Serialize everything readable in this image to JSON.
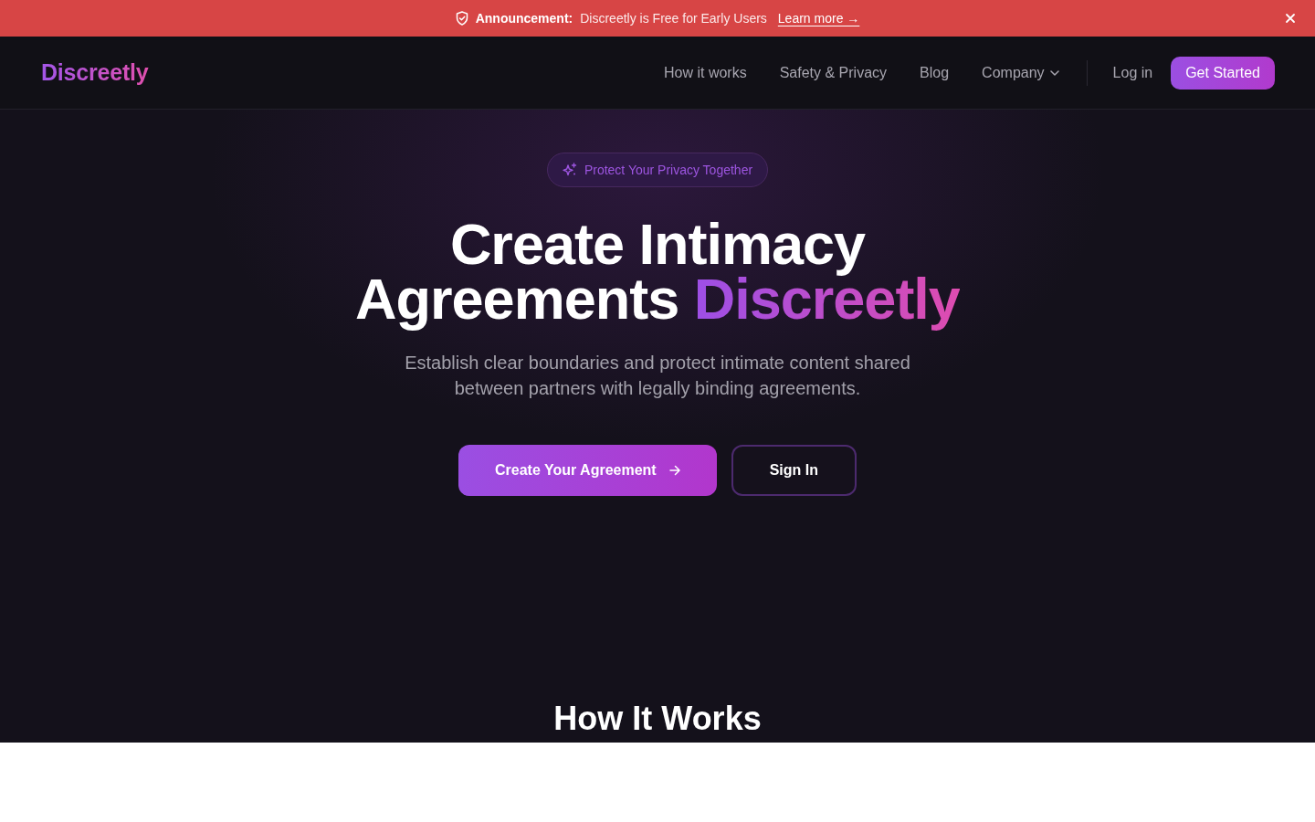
{
  "announcement": {
    "label": "Announcement:",
    "message": "Discreetly is Free for Early Users",
    "link": "Learn more →"
  },
  "navbar": {
    "brand": "Discreetly",
    "links": [
      {
        "label": "How it works",
        "kind": "link"
      },
      {
        "label": "Safety & Privacy",
        "kind": "link"
      },
      {
        "label": "Blog",
        "kind": "link"
      },
      {
        "label": "Company",
        "kind": "dropdown"
      }
    ],
    "login": "Log in",
    "cta": "Get Started"
  },
  "hero": {
    "badge": "Protect Your Privacy Together",
    "headline": {
      "lines": [
        "Create Intimacy",
        "Agreements"
      ],
      "highlight": "Discreetly"
    },
    "subtitle": "Establish clear boundaries and protect intimate content shared between partners with legally binding agreements.",
    "buttons": [
      {
        "label": "Create Your Agreement",
        "kind": "primary"
      },
      {
        "label": "Sign In",
        "kind": "outline"
      }
    ]
  },
  "section": {
    "title": "How It Works"
  }
}
